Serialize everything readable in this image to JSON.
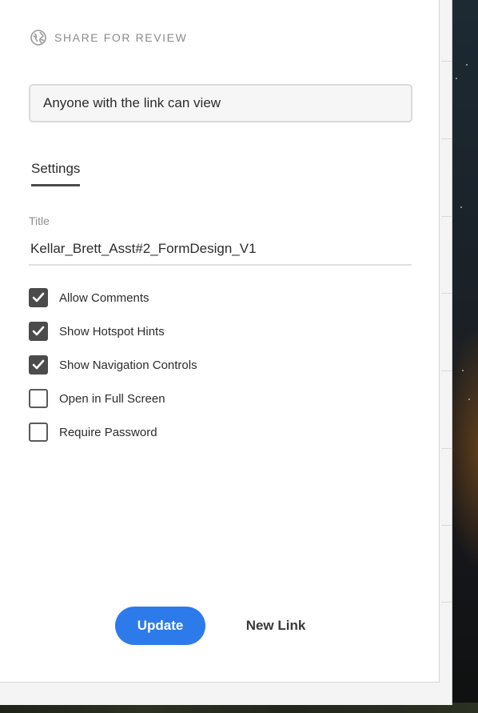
{
  "header": {
    "icon": "globe-icon",
    "title": "SHARE FOR REVIEW"
  },
  "access": {
    "selected": "Anyone with the link can view"
  },
  "tabs": [
    {
      "label": "Settings",
      "active": true
    }
  ],
  "title_field": {
    "label": "Title",
    "value": "Kellar_Brett_Asst#2_FormDesign_V1"
  },
  "options": [
    {
      "label": "Allow Comments",
      "checked": true
    },
    {
      "label": "Show Hotspot Hints",
      "checked": true
    },
    {
      "label": "Show Navigation Controls",
      "checked": true
    },
    {
      "label": "Open in Full Screen",
      "checked": false
    },
    {
      "label": "Require Password",
      "checked": false
    }
  ],
  "actions": {
    "update_label": "Update",
    "new_link_label": "New Link"
  },
  "colors": {
    "primary": "#2d7bea",
    "checkbox": "#4b4b4b"
  }
}
